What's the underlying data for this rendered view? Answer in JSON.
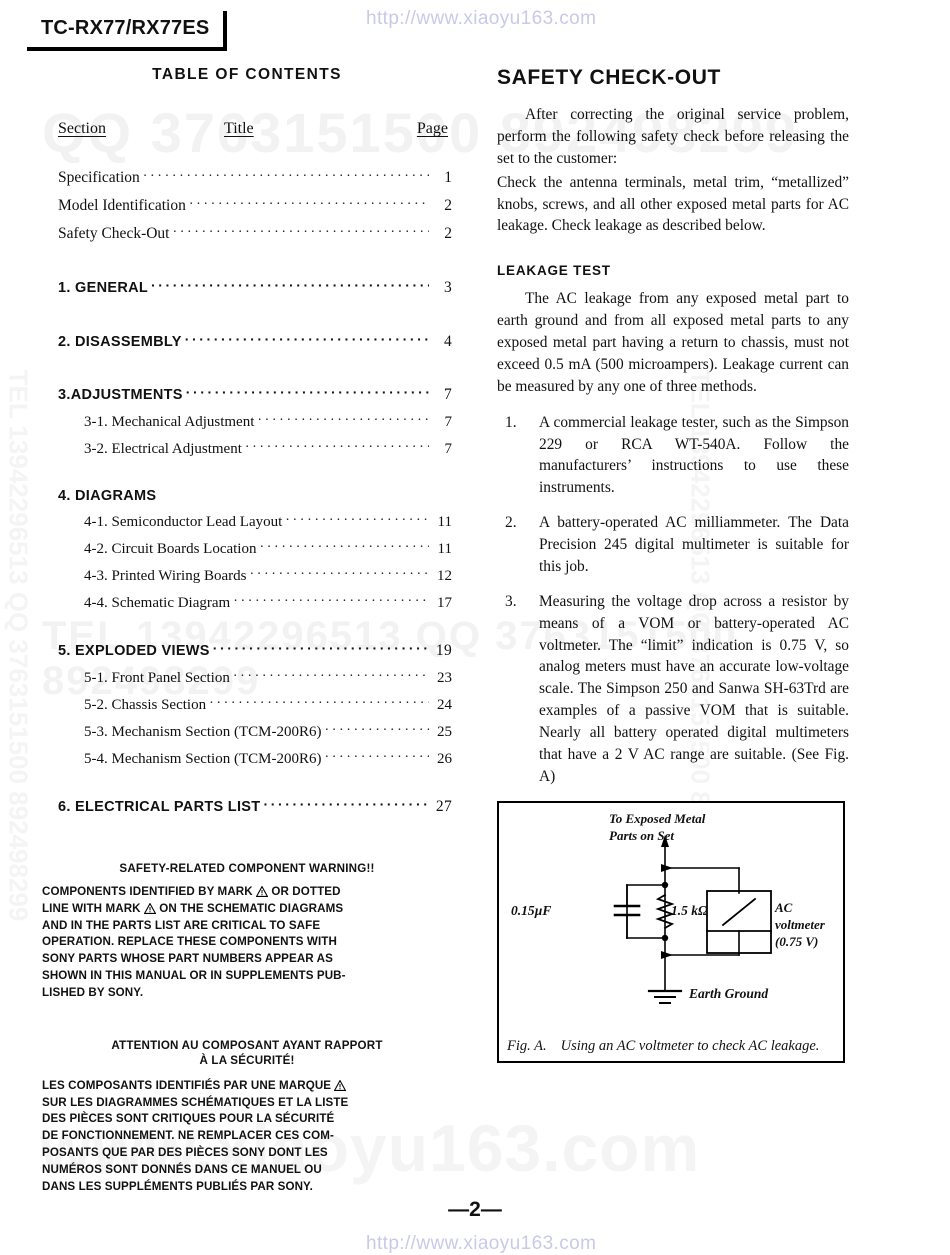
{
  "watermarks": {
    "url_top": "http://www.xiaoyu163.com",
    "url_bottom": "http://www.xiaoyu163.com",
    "horizontal_1": "QQ 3763151500  892498299",
    "horizontal_2": "TEL 13942296513   QQ 3763151500  892498299",
    "big_bottom": "www.xiaoyu163.com",
    "vertical_left": "TEL 13942296513  QQ 3763151500  892498299",
    "vertical_right": "TEL 13942296513  QQ 3763151500  892498299",
    "url_color": "#c9c9e8",
    "gray_color": "#f2f2f2"
  },
  "model": {
    "title": "TC-RX77/RX77ES"
  },
  "toc": {
    "heading": "TABLE OF CONTENTS",
    "columns": {
      "section": "Section",
      "title": "Title",
      "page": "Page"
    },
    "entries": [
      {
        "label": "Specification",
        "page": "1",
        "style": "plain",
        "indent": 0
      },
      {
        "label": "Model  Identification",
        "page": "2",
        "style": "plain",
        "indent": 0
      },
      {
        "label": "Safety  Check-Out",
        "page": "2",
        "style": "plain",
        "indent": 0
      },
      {
        "label": "1. GENERAL",
        "page": "3",
        "style": "major",
        "indent": 0
      },
      {
        "label": "2. DISASSEMBLY",
        "page": "4",
        "style": "major",
        "indent": 0
      },
      {
        "label": "3.ADJUSTMENTS",
        "page": "7",
        "style": "major",
        "indent": 0
      },
      {
        "label": "3-1. Mechanical  Adjustment",
        "page": "7",
        "style": "sub",
        "indent": 1
      },
      {
        "label": "3-2. Electrical  Adjustment",
        "page": "7",
        "style": "sub",
        "indent": 1
      },
      {
        "label": "4. DIAGRAMS",
        "page": "",
        "style": "major-nodots",
        "indent": 0
      },
      {
        "label": "4-1. Semiconductor  Lead  Layout",
        "page": "11",
        "style": "sub",
        "indent": 1
      },
      {
        "label": "4-2. Circuit  Boards  Location",
        "page": "11",
        "style": "sub",
        "indent": 1
      },
      {
        "label": "4-3. Printed  Wiring  Boards",
        "page": "12",
        "style": "sub",
        "indent": 1
      },
      {
        "label": "4-4. Schematic  Diagram",
        "page": "17",
        "style": "sub",
        "indent": 1
      },
      {
        "label": "5. EXPLODED  VIEWS",
        "page": "19",
        "style": "major",
        "indent": 0
      },
      {
        "label": "5-1. Front  Panel  Section",
        "page": "23",
        "style": "sub",
        "indent": 1
      },
      {
        "label": "5-2. Chassis  Section",
        "page": "24",
        "style": "sub",
        "indent": 1
      },
      {
        "label": "5-3. Mechanism  Section  (TCM-200R6)",
        "page": "25",
        "style": "sub",
        "indent": 1
      },
      {
        "label": "5-4. Mechanism  Section  (TCM-200R6)",
        "page": "26",
        "style": "sub",
        "indent": 1
      },
      {
        "label": "6. ELECTRICAL  PARTS  LIST",
        "page": "27",
        "style": "major",
        "indent": 0
      }
    ]
  },
  "warning_en": {
    "heading": "SAFETY-RELATED COMPONENT WARNING!!",
    "lines": [
      "COMPONENTS IDENTIFIED BY MARK ⚠ OR DOTTED",
      "LINE WITH MARK ⚠ ON THE SCHEMATIC DIAGRAMS",
      "AND IN THE PARTS LIST ARE CRITICAL TO SAFE",
      "OPERATION.  REPLACE THESE COMPONENTS WITH",
      "SONY PARTS WHOSE PART NUMBERS APPEAR AS",
      "SHOWN IN THIS MANUAL OR IN SUPPLEMENTS PUB-",
      "LISHED BY SONY."
    ]
  },
  "warning_fr": {
    "heading_line1": "ATTENTION AU COMPOSANT AYANT RAPPORT",
    "heading_line2": "À LA SÉCURITÉ!",
    "lines": [
      "LES COMPOSANTS IDENTIFIÉS PAR UNE MARQUE ⚠",
      "SUR LES DIAGRAMMES SCHÉMATIQUES ET LA LISTE",
      "DES PIÈCES SONT CRITIQUES POUR LA SÉCURITÉ",
      "DE FONCTIONNEMENT.  NE REMPLACER CES COM-",
      "POSANTS QUE PAR DES PIÈCES SONY DONT LES",
      "NUMÉROS SONT DONNÉS DANS CE MANUEL OU",
      "DANS LES SUPPLÉMENTS PUBLIÉS PAR SONY."
    ]
  },
  "safety": {
    "heading": "SAFETY CHECK-OUT",
    "intro_p1": "After correcting the original service problem, perform the following safety check before releasing the set to the customer:",
    "intro_p2": "Check the antenna terminals, metal trim, “metallized” knobs, screws, and all other exposed metal parts for AC leakage.  Check leakage as described below.",
    "leakage_heading": "LEAKAGE TEST",
    "leakage_intro": "The AC leakage from any exposed metal part to earth ground and from all exposed metal parts to any exposed metal part having a return to chassis, must not exceed 0.5 mA (500 microampers).   Leakage current can be measured by any one of three methods.",
    "methods": [
      {
        "n": "1.",
        "text": "A commercial leakage tester, such as the Simpson 229 or RCA WT-540A.  Follow the manufacturers’ instructions to use these instruments."
      },
      {
        "n": "2.",
        "text": "A battery-operated AC milliammeter. The Data Precision 245 digital multimeter is suitable for this job."
      },
      {
        "n": "3.",
        "text": "Measuring the voltage drop across a resistor by means of a VOM or battery-operated AC voltmeter.   The “limit” indication is 0.75 V, so analog meters must have an accurate low-voltage scale.   The Simpson 250 and Sanwa SH-63Trd are examples of a passive VOM that is suitable.  Nearly all battery operated digital multimeters that have a 2 V AC range are suitable.  (See Fig. A)"
      }
    ]
  },
  "figure": {
    "caption_label": "Fig. A.",
    "caption_text": "Using an AC voltmeter to check AC leakage.",
    "label_top_line1": "To Exposed Metal",
    "label_top_line2": "Parts on Set",
    "label_cap": "0.15µF",
    "label_res": "1.5 kΩ",
    "label_meter_line1": "AC",
    "label_meter_line2": "voltmeter",
    "label_meter_line3": "(0.75 V)",
    "label_ground": "Earth Ground"
  },
  "footer": {
    "page_number": "—2—"
  }
}
